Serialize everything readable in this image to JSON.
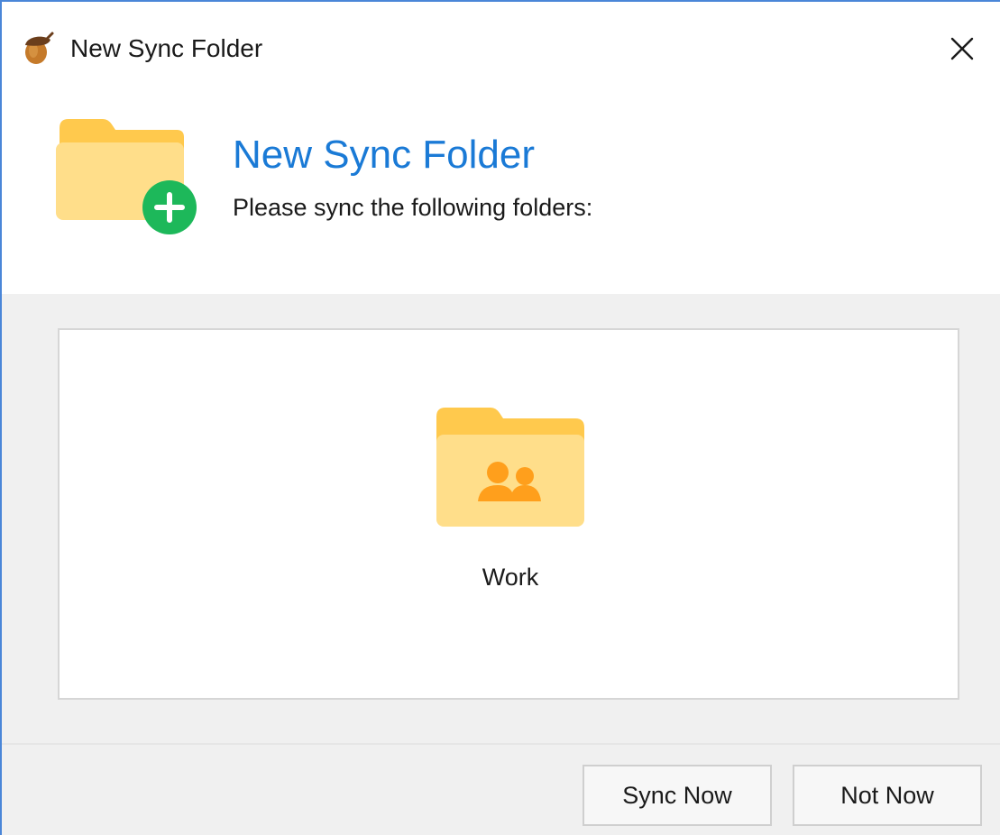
{
  "window": {
    "title": "New Sync Folder",
    "app_icon": "acorn-icon",
    "close_icon": "close-icon"
  },
  "header": {
    "icon": "folder-add-icon",
    "title": "New Sync Folder",
    "subtitle": "Please sync the following folders:"
  },
  "folders": [
    {
      "icon": "shared-folder-icon",
      "label": "Work"
    }
  ],
  "buttons": {
    "sync_now": "Sync Now",
    "not_now": "Not Now"
  },
  "colors": {
    "accent": "#1a7ad6",
    "window_border": "#4a86d8",
    "folder": "#ffde8a",
    "folder_tab": "#ffc94d",
    "add_badge": "#1db85a",
    "people": "#ff9f1c"
  }
}
